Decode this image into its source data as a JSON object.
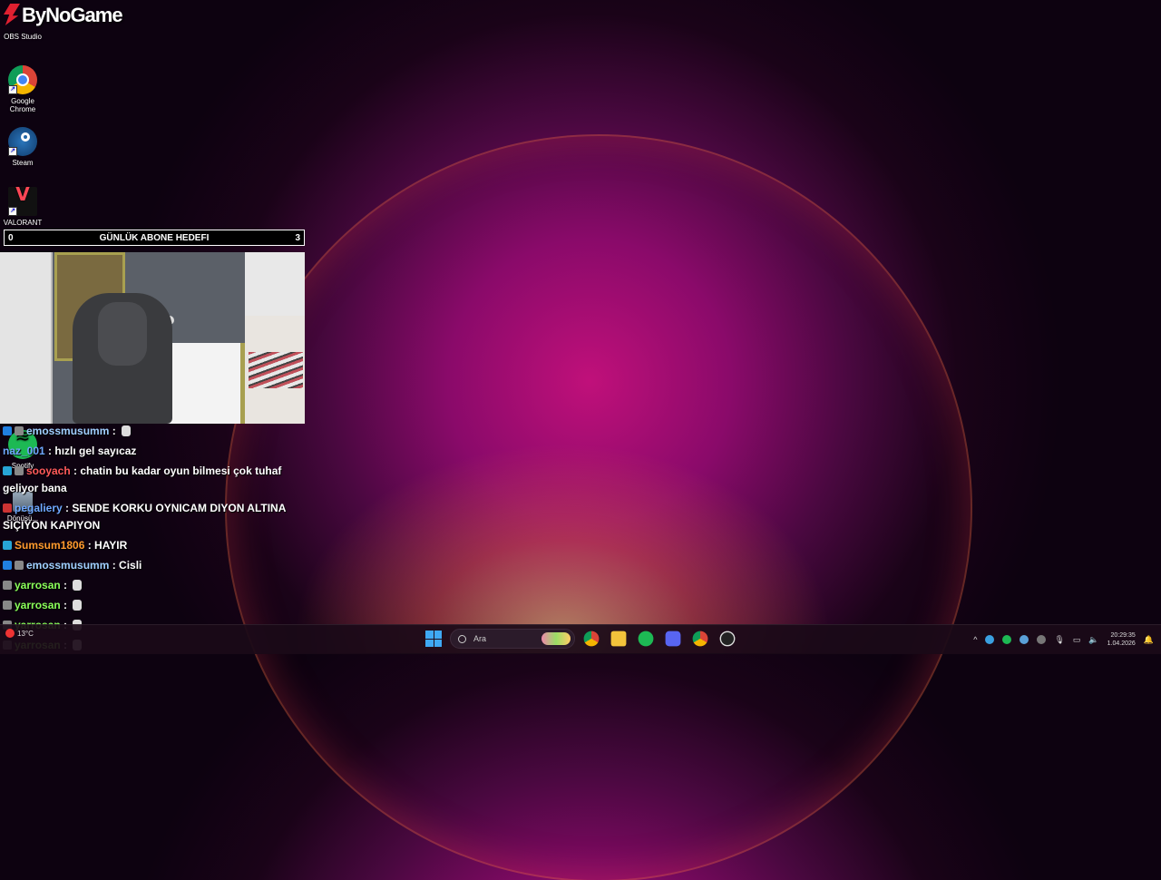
{
  "brand": {
    "name": "ByNoGame"
  },
  "desktop_icons": [
    {
      "label": "OBS Studio",
      "icon": "obs-icon"
    },
    {
      "label": "Google Chrome",
      "icon": "chrome-icon"
    },
    {
      "label": "Steam",
      "icon": "steam-icon"
    },
    {
      "label": "VALORANT",
      "icon": "valorant-icon"
    },
    {
      "label": "Spotify",
      "icon": "spotify-icon"
    },
    {
      "label": "Dönüşü...",
      "icon": "recycle-bin-icon"
    }
  ],
  "goal": {
    "title": "GÜNLÜK ABONE HEDEFI",
    "current": "0",
    "target": "3"
  },
  "chat": [
    {
      "user": "emossmusumm",
      "color": "#a0d0ff",
      "message": "",
      "emote": true,
      "badges": [
        "prime",
        "sub"
      ]
    },
    {
      "user": "naz_001",
      "color": "#6fa8ff",
      "message": "hızlı gel sayıcaz",
      "emote": false,
      "badges": []
    },
    {
      "user": "sooyach",
      "color": "#ff5a5a",
      "message": "chatin bu kadar oyun bilmesi çok tuhaf geliyor bana",
      "emote": false,
      "badges": [
        "gift",
        "sub"
      ]
    },
    {
      "user": "pegaliery",
      "color": "#6fa8ff",
      "message": "SENDE KORKU OYNICAM DIYON ALTINA SIÇIYON KAPIYON",
      "emote": false,
      "badges": [
        "red"
      ]
    },
    {
      "user": "Sumsum1806",
      "color": "#ff9a2e",
      "message": "HAYIR",
      "emote": false,
      "badges": [
        "gift"
      ]
    },
    {
      "user": "emossmusumm",
      "color": "#a0d0ff",
      "message": "Cisli",
      "emote": false,
      "badges": [
        "prime",
        "sub"
      ]
    },
    {
      "user": "yarrosan",
      "color": "#8aff5a",
      "message": "",
      "emote": true,
      "badges": [
        "sub"
      ]
    },
    {
      "user": "yarrosan",
      "color": "#8aff5a",
      "message": "",
      "emote": true,
      "badges": [
        "sub"
      ]
    },
    {
      "user": "yarrosan",
      "color": "#8aff5a",
      "message": "",
      "emote": true,
      "badges": [
        "sub"
      ]
    },
    {
      "user": "yarrosan",
      "color": "#8aff5a",
      "message": "",
      "emote": true,
      "badges": [
        "sub"
      ]
    }
  ],
  "taskbar": {
    "weather": "13°C",
    "search_placeholder": "Ara",
    "apps": [
      "chrome-icon",
      "file-explorer-icon",
      "spotify-icon",
      "discord-icon",
      "chrome-profile-icon",
      "obs-icon"
    ],
    "time": "20:29:35",
    "date": "1.04.2026"
  }
}
